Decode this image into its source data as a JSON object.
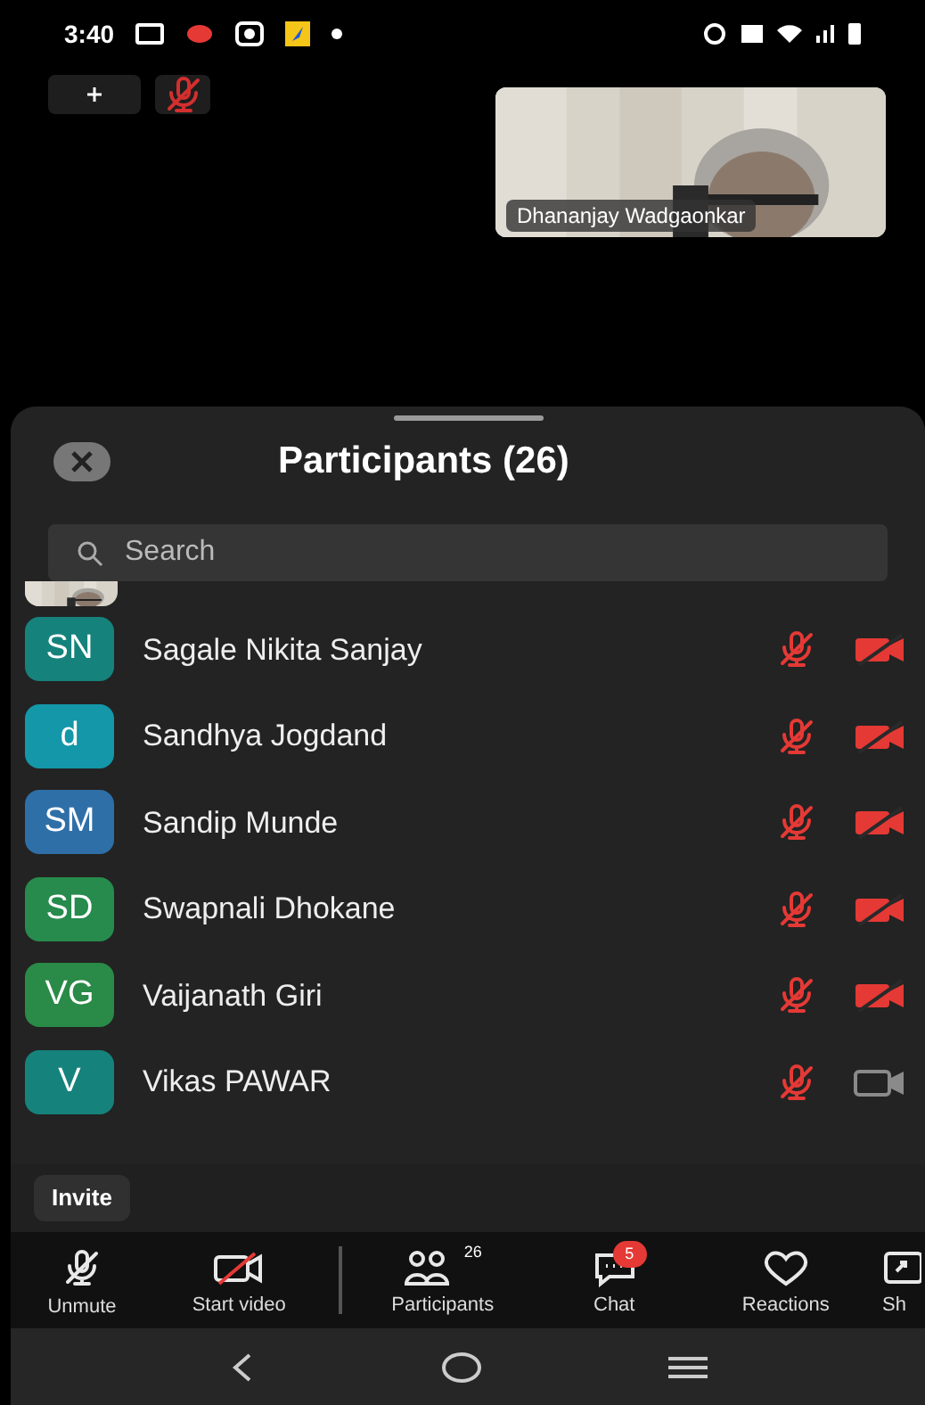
{
  "status_bar": {
    "time": "3:40"
  },
  "self_view": {
    "muted": true
  },
  "video_tile": {
    "name": "Dhananjay Wadgaonkar"
  },
  "panel": {
    "title": "Participants (26)"
  },
  "search": {
    "placeholder": "Search"
  },
  "participants": [
    {
      "name": "Sagale Nikita Sanjay",
      "initials": "SN",
      "color": "#16827c",
      "mic_muted": true,
      "video_off": true
    },
    {
      "name": "Sandhya Jogdand",
      "initials": "d",
      "color": "#1397a9",
      "mic_muted": true,
      "video_off": true
    },
    {
      "name": "Sandip Munde",
      "initials": "SM",
      "color": "#2f6fa7",
      "mic_muted": true,
      "video_off": true
    },
    {
      "name": "Swapnali Dhokane",
      "initials": "SD",
      "color": "#278b4d",
      "mic_muted": true,
      "video_off": true
    },
    {
      "name": "Vaijanath Giri",
      "initials": "VG",
      "color": "#2a8a47",
      "mic_muted": true,
      "video_off": true
    },
    {
      "name": "Vikas PAWAR",
      "initials": "V",
      "color": "#16827c",
      "mic_muted": true,
      "video_off": false
    }
  ],
  "invite_button": "Invite",
  "toolbar": [
    {
      "kind": "mic",
      "label": "Unmute"
    },
    {
      "kind": "video",
      "label": "Start video"
    },
    {
      "kind": "participants",
      "label": "Participants",
      "count": "26"
    },
    {
      "kind": "chat",
      "label": "Chat",
      "badge": "5"
    },
    {
      "kind": "reactions",
      "label": "Reactions"
    },
    {
      "kind": "share",
      "label": "Sh"
    }
  ]
}
